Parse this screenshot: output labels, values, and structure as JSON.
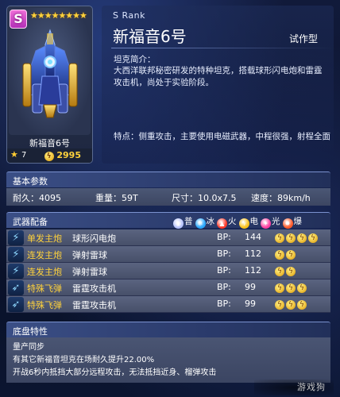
{
  "unit": {
    "rank_letter": "S",
    "stars": "★★★★★★★★",
    "name": "新福音6号",
    "level": "7",
    "power": "2995",
    "rank_label": "S  Rank",
    "title": "新福音6号",
    "type": "试作型",
    "intro_head": "坦克简介：",
    "intro": "大西洋联邦秘密研发的特种坦克，搭载球形闪电炮和雷霆攻击机，尚处于实验阶段。",
    "features": "特点：侧重攻击，主要使用电磁武器，中程很强，射程全面"
  },
  "basic": {
    "section_title": "基本参数",
    "durability": "耐久：4095",
    "weight": "重量：59T",
    "size": "尺寸：10.0x7.5",
    "speed": "速度：89km/h"
  },
  "weapons": {
    "section_title": "武器配备",
    "legend": [
      {
        "label": "普",
        "color": "#b8c4ff",
        "icon": "normal-icon",
        "glyph": "◉"
      },
      {
        "label": "冰",
        "color": "#2aa8ff",
        "icon": "ice-icon",
        "glyph": "❄"
      },
      {
        "label": "火",
        "color": "#ff3a2a",
        "icon": "fire-icon",
        "glyph": "▲"
      },
      {
        "label": "电",
        "color": "#ffc21a",
        "icon": "electric-icon",
        "glyph": "ϟ"
      },
      {
        "label": "光",
        "color": "#ff3fa0",
        "icon": "light-icon",
        "glyph": "✦"
      },
      {
        "label": "爆",
        "color": "#ff5a2a",
        "icon": "explosive-icon",
        "glyph": "✸"
      }
    ],
    "bp_label": "BP:",
    "items": [
      {
        "type": "单发主炮",
        "name": "球形闪电炮",
        "bp": "144",
        "elements": 4
      },
      {
        "type": "连发主炮",
        "name": "弹射雷球",
        "bp": "112",
        "elements": 2
      },
      {
        "type": "连发主炮",
        "name": "弹射雷球",
        "bp": "112",
        "elements": 2
      },
      {
        "type": "特殊飞弹",
        "name": "雷霆攻击机",
        "bp": "99",
        "elements": 3
      },
      {
        "type": "特殊飞弹",
        "name": "雷霆攻击机",
        "bp": "99",
        "elements": 3
      }
    ]
  },
  "chassis": {
    "section_title": "底盘特性",
    "lines": [
      "量产同步",
      "有其它新福音坦克在场耐久提升22.00%",
      "开战6秒内抵挡大部分远程攻击，无法抵挡近身、榴弹攻击"
    ]
  },
  "watermark": "游戏狗"
}
